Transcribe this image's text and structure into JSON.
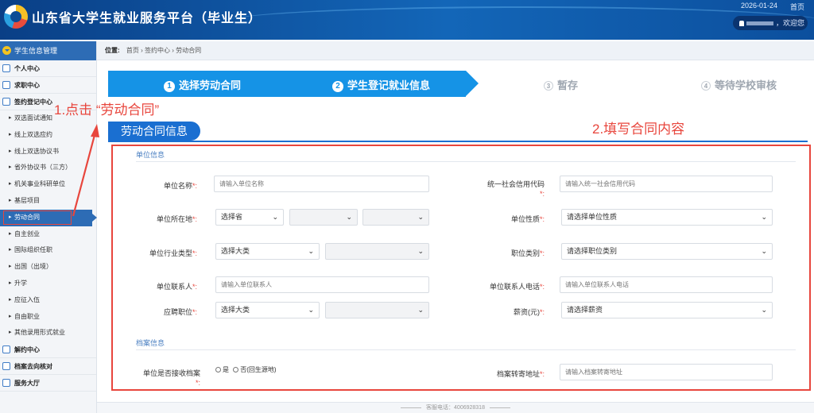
{
  "header": {
    "title": "山东省大学生就业服务平台（毕业生）",
    "date": "2026-01-24",
    "home_link": "首页",
    "greeting": "，欢迎您"
  },
  "sidebar": {
    "head": "学生信息管理",
    "categories": {
      "personal": "个人中心",
      "job": "求职中心",
      "contract": "签约登记中心",
      "termination": "解约中心",
      "archive": "档案去向核对",
      "service": "服务大厅"
    },
    "contract_items": [
      "双选面试通知",
      "线上双选应约",
      "线上双选协议书",
      "省外协议书（三方）",
      "机关事业科研单位",
      "基层项目",
      "劳动合同",
      "自主创业",
      "国际组织任职",
      "出国（出境）",
      "升学",
      "应征入伍",
      "自由职业",
      "其他录用形式就业"
    ],
    "active_item": "劳动合同"
  },
  "breadcrumb": {
    "label": "位置:",
    "path": "首页 › 签约中心 › 劳动合同"
  },
  "steps": [
    {
      "num": "1",
      "label": "选择劳动合同",
      "state": "done"
    },
    {
      "num": "2",
      "label": "学生登记就业信息",
      "state": "current"
    },
    {
      "num": "3",
      "label": "暂存",
      "state": "pending"
    },
    {
      "num": "4",
      "label": "等待学校审核",
      "state": "pending"
    }
  ],
  "annotations": {
    "step1": "1.点击 “劳动合同”",
    "step2": "2.填写合同内容"
  },
  "section_title": "劳动合同信息",
  "form": {
    "unit_group": "单位信息",
    "archive_group": "档案信息",
    "unit_name": {
      "label": "单位名称",
      "placeholder": "请输入单位名称"
    },
    "credit_code": {
      "label": "统一社会信用代码",
      "placeholder": "请输入统一社会信用代码"
    },
    "location": {
      "label": "单位所在地",
      "province": "选择省"
    },
    "nature": {
      "label": "单位性质",
      "value": "请选择单位性质"
    },
    "industry": {
      "label": "单位行业类型",
      "value": "选择大类"
    },
    "job_type": {
      "label": "职位类别",
      "value": "请选择职位类别"
    },
    "contact": {
      "label": "单位联系人",
      "placeholder": "请输入单位联系人"
    },
    "contact_phone": {
      "label": "单位联系人电话",
      "placeholder": "请输入单位联系人电话"
    },
    "position": {
      "label": "应聘职位",
      "value": "选择大类"
    },
    "salary": {
      "label": "薪资(元)",
      "value": "请选择薪资"
    },
    "accept_archive": {
      "label": "单位是否接收档案",
      "yes": "是",
      "no": "否(回生源地)"
    },
    "archive_address": {
      "label": "档案转寄地址",
      "placeholder": "请输入档案转寄地址"
    },
    "required_mark": "*:",
    "colon": ":"
  },
  "footer": {
    "hotline": "客服电话：4006928318"
  },
  "colors": {
    "header_blue": "#0d4b95",
    "step_blue": "#1593e6",
    "annotation_red": "#e8463d"
  }
}
